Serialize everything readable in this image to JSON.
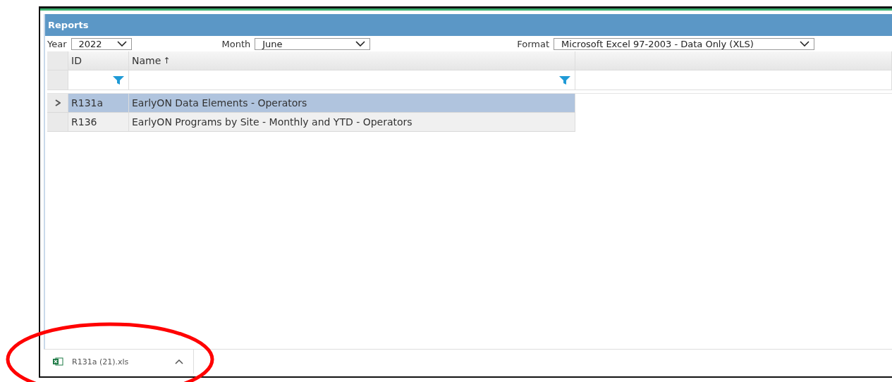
{
  "panel": {
    "title": "Reports"
  },
  "filters": [
    {
      "label": "Year",
      "value": "2022",
      "kind": "short"
    },
    {
      "label": "Month",
      "value": "June",
      "kind": "medium"
    },
    {
      "label": "Format",
      "value": "Microsoft Excel 97-2003 - Data Only (XLS)",
      "kind": "long"
    }
  ],
  "table": {
    "columns": [
      {
        "label": "ID",
        "filter": true
      },
      {
        "label": "Name",
        "sort_mark": "↑",
        "filter": true
      }
    ],
    "rows": [
      {
        "id": "R131a",
        "name": "EarlyON Data Elements - Operators",
        "selected": true
      },
      {
        "id": "R136",
        "name": "EarlyON Programs by Site - Monthly and YTD - Operators",
        "selected": false
      }
    ]
  },
  "download": {
    "file": "R131a (21).xls"
  }
}
